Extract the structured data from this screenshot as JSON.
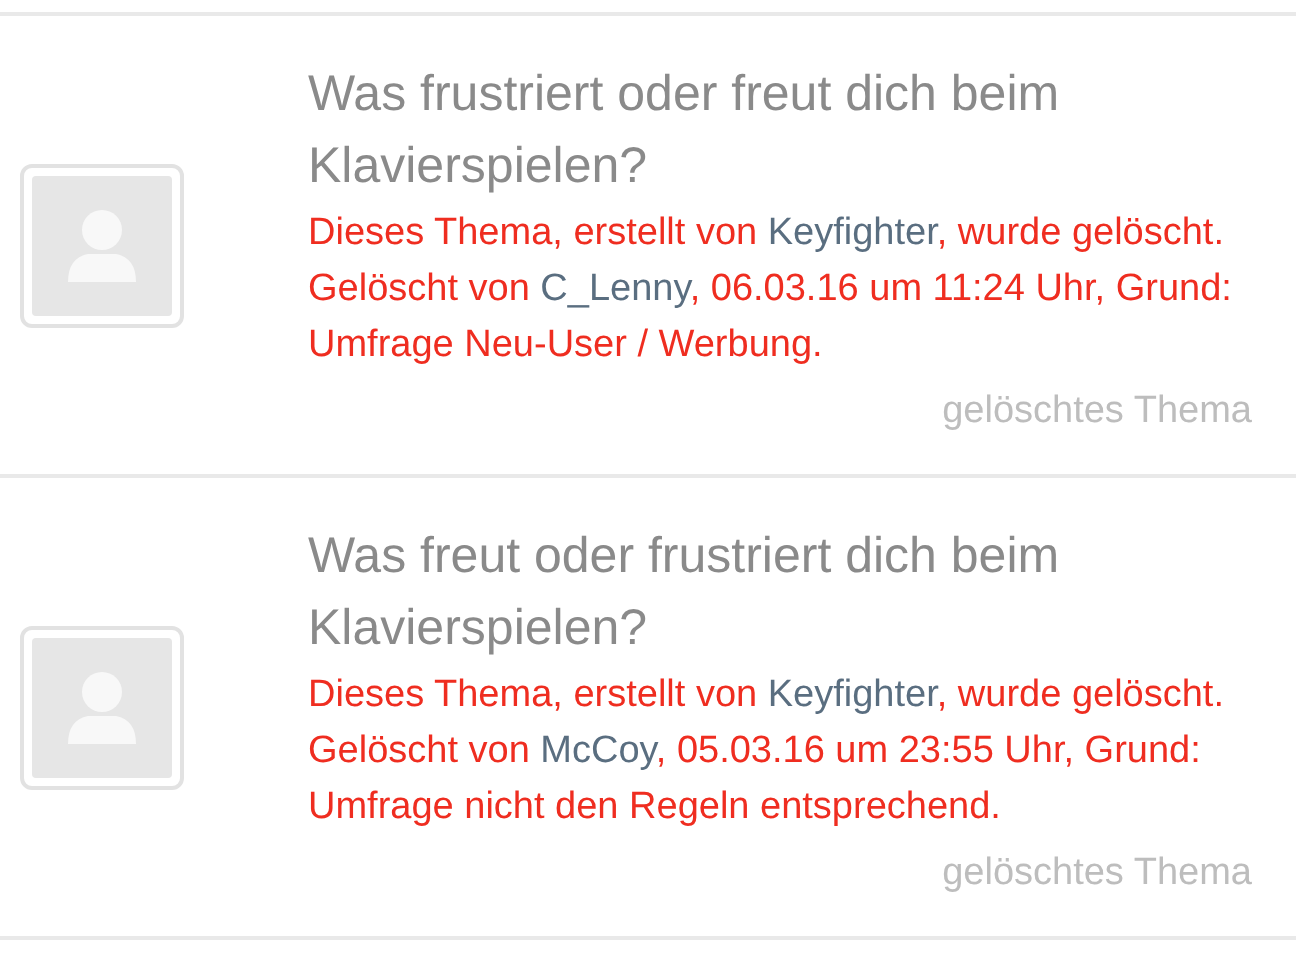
{
  "threads": [
    {
      "title": "Was frustriert oder freut dich beim Klavierspielen?",
      "message_parts": [
        {
          "kind": "text",
          "text": "Dieses Thema, erstellt von "
        },
        {
          "kind": "user",
          "text": "Keyfighter"
        },
        {
          "kind": "text",
          "text": ", wurde gelöscht. Gelöscht von "
        },
        {
          "kind": "user",
          "text": "C_Lenny"
        },
        {
          "kind": "text",
          "text": ", 06.03.16 um 11:24 Uhr, Grund: Umfrage Neu-User / Werbung."
        }
      ],
      "status": "gelöschtes Thema"
    },
    {
      "title": "Was freut oder frustriert dich beim Klavierspielen?",
      "message_parts": [
        {
          "kind": "text",
          "text": "Dieses Thema, erstellt von "
        },
        {
          "kind": "user",
          "text": "Keyfighter"
        },
        {
          "kind": "text",
          "text": ", wurde gelöscht. Gelöscht von "
        },
        {
          "kind": "user",
          "text": "McCoy"
        },
        {
          "kind": "text",
          "text": ", 05.03.16 um 23:55 Uhr, Grund: Umfrage nicht den Regeln entsprechend."
        }
      ],
      "status": "gelöschtes Thema"
    }
  ]
}
